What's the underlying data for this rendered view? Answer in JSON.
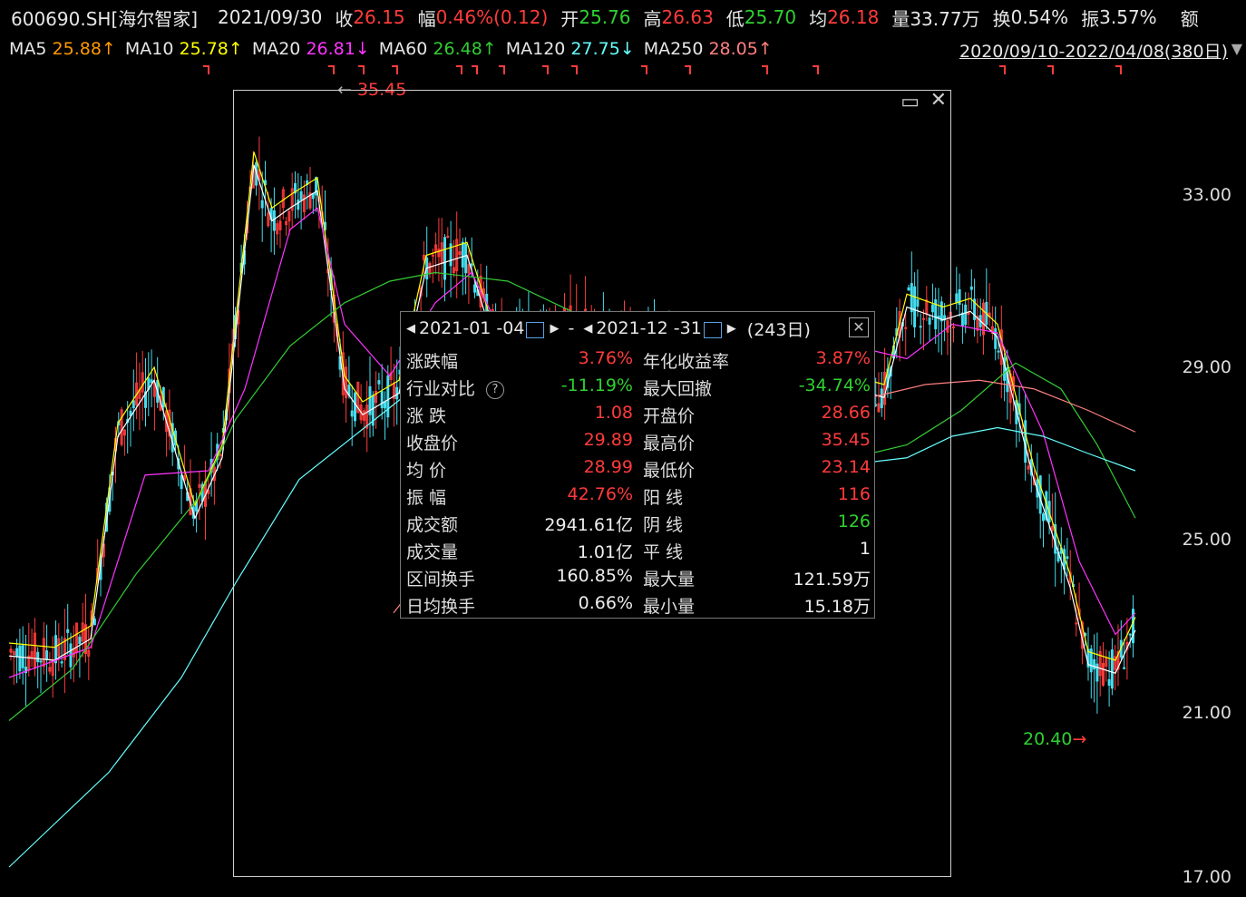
{
  "header": {
    "symbol": "600690.SH[海尔智家]",
    "date": "2021/09/30",
    "close_label": "收",
    "close_value": "26.15",
    "change_label": "幅",
    "change_value": "0.46%(0.12)",
    "open_label": "开",
    "open_value": "25.76",
    "high_label": "高",
    "high_value": "26.63",
    "low_label": "低",
    "low_value": "25.70",
    "avg_label": "均",
    "avg_value": "26.18",
    "volume_label": "量",
    "volume_value": "33.77万",
    "turnover_label": "换",
    "turnover_value": "0.54%",
    "amplitude_label": "振",
    "amplitude_value": "3.57%",
    "amount_label": "额"
  },
  "ma_bar": {
    "items": [
      {
        "label": "MA5",
        "value": "25.88↑",
        "color": "#ff9900"
      },
      {
        "label": "MA10",
        "value": "25.78↑",
        "color": "#ffff00"
      },
      {
        "label": "MA20",
        "value": "26.81↓",
        "color": "#ff33ff"
      },
      {
        "label": "MA60",
        "value": "26.48↑",
        "color": "#33cc33"
      },
      {
        "label": "MA120",
        "value": "27.75↓",
        "color": "#66ffff"
      },
      {
        "label": "MA250",
        "value": "28.05↑",
        "color": "#ff8080"
      }
    ],
    "range": "2020/09/10-2022/04/08(380日)"
  },
  "price_axis": [
    "33.00",
    "29.00",
    "25.00",
    "21.00",
    "17.00"
  ],
  "annotations": {
    "high": "35.45",
    "low": "20.40"
  },
  "panel": {
    "start_date": "2021-01 -04",
    "dash": "-",
    "end_date": "2021-12 -31",
    "days": "(243日)",
    "rows": [
      {
        "k1": "涨跌幅",
        "v1": "3.76%",
        "c1": "red",
        "k2": "年化收益率",
        "v2": "3.87%",
        "c2": "red"
      },
      {
        "k1": "行业对比",
        "v1": "-11.19%",
        "c1": "green",
        "k2": "最大回撤",
        "v2": "-34.74%",
        "c2": "green"
      },
      {
        "k1": "涨  跌",
        "v1": "1.08",
        "c1": "red",
        "k2": "开盘价",
        "v2": "28.66",
        "c2": "red"
      },
      {
        "k1": "收盘价",
        "v1": "29.89",
        "c1": "red",
        "k2": "最高价",
        "v2": "35.45",
        "c2": "red"
      },
      {
        "k1": "均  价",
        "v1": "28.99",
        "c1": "red",
        "k2": "最低价",
        "v2": "23.14",
        "c2": "red"
      },
      {
        "k1": "振  幅",
        "v1": "42.76%",
        "c1": "red",
        "k2": "阳  线",
        "v2": "116",
        "c2": "red"
      },
      {
        "k1": "成交额",
        "v1": "2941.61亿",
        "c1": "white",
        "k2": "阴  线",
        "v2": "126",
        "c2": "green"
      },
      {
        "k1": "成交量",
        "v1": "1.01亿",
        "c1": "white",
        "k2": "平 线",
        "v2": "1",
        "c2": "white"
      },
      {
        "k1": "区间换手",
        "v1": "160.85%",
        "c1": "white",
        "k2": "最大量",
        "v2": "121.59万",
        "c2": "white"
      },
      {
        "k1": "日均换手",
        "v1": "0.66%",
        "c1": "white",
        "k2": "最小量",
        "v2": "15.18万",
        "c2": "white"
      }
    ]
  },
  "colors": {
    "up": "#ff3b3b",
    "down": "#2fd12f",
    "candle_down": "#44ddee",
    "ma5": "#ffffff",
    "ma10": "#ffff00",
    "ma20": "#ff33ff",
    "ma60": "#33cc33",
    "ma120": "#66ffff",
    "ma250": "#ff8080"
  }
}
